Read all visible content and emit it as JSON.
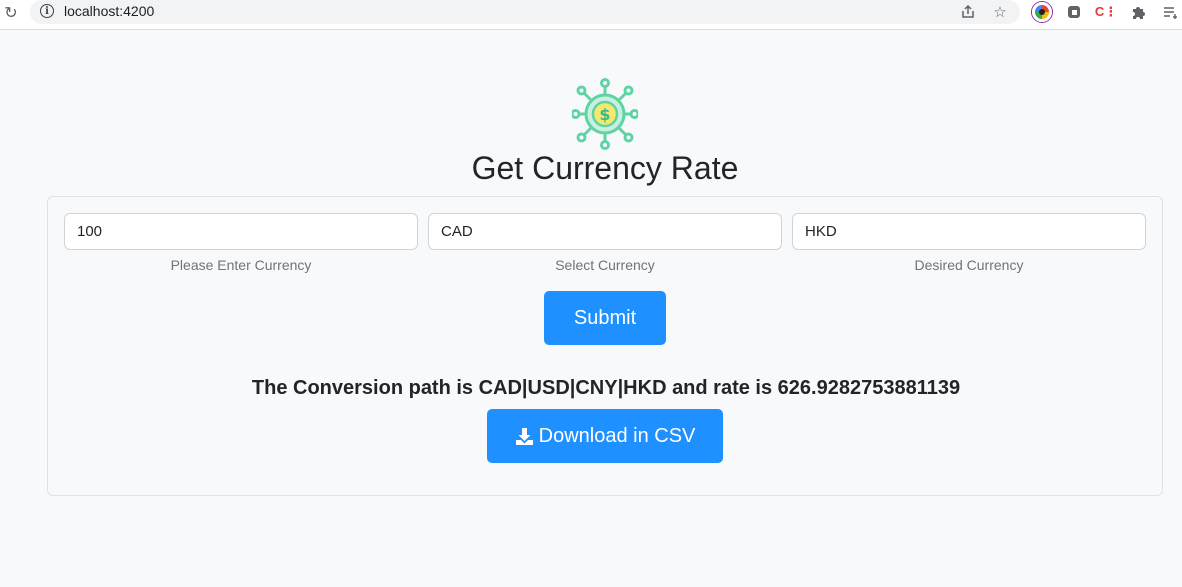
{
  "browser": {
    "url": "localhost:4200"
  },
  "page": {
    "title": "Get Currency Rate"
  },
  "form": {
    "amount": {
      "value": "100",
      "help": "Please Enter Currency"
    },
    "from_currency": {
      "value": "CAD",
      "help": "Select Currency"
    },
    "to_currency": {
      "value": "HKD",
      "help": "Desired Currency"
    },
    "submit_label": "Submit"
  },
  "result": {
    "text": "The Conversion path is CAD|USD|CNY|HKD and rate is 626.9282753881139"
  },
  "download": {
    "label": "Download in CSV"
  },
  "colors": {
    "primary_button": "#1e90ff",
    "page_background": "#f8f9fa",
    "logo_teal": "#5fd3a6",
    "logo_coin": "#f5e86a"
  },
  "icons": [
    "reload-icon",
    "info-icon",
    "share-icon",
    "star-icon",
    "extension-icon",
    "puzzle-icon",
    "reading-list-icon",
    "currency-network-logo",
    "download-icon"
  ]
}
